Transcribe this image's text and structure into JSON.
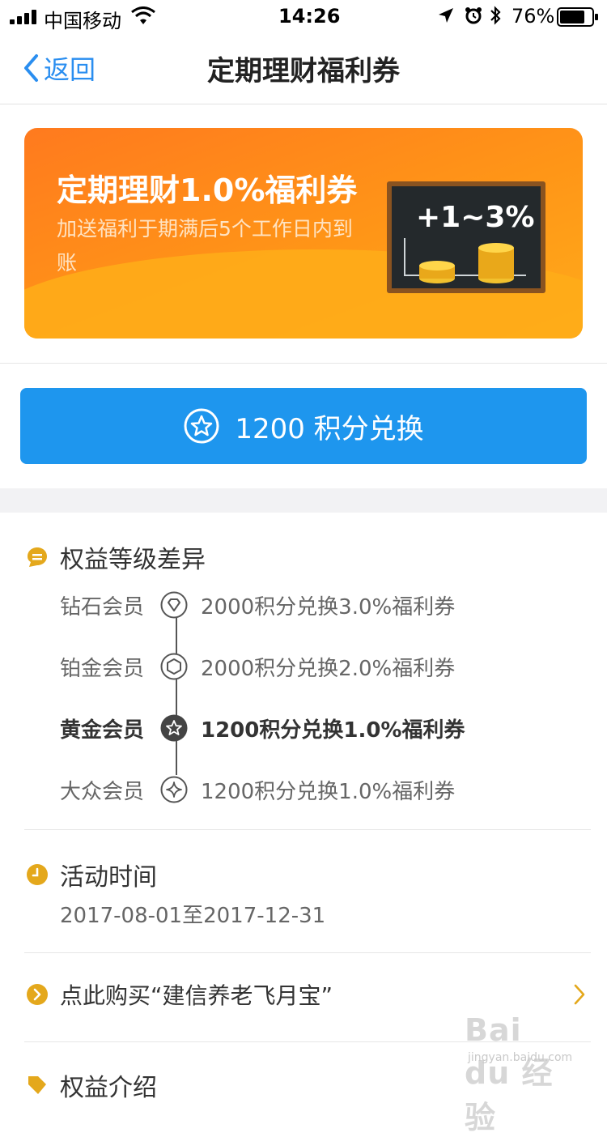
{
  "status_bar": {
    "carrier": "中国移动",
    "time": "14:26",
    "battery": "76%"
  },
  "nav": {
    "back_label": "返回",
    "title": "定期理财福利券"
  },
  "banner": {
    "title": "定期理财1.0%福利券",
    "subtitle": "加送福利于期满后5个工作日内到账",
    "board_text": "+1~3%"
  },
  "exchange_button": {
    "label": "1200 积分兑换"
  },
  "tiers_section": {
    "title": "权益等级差异",
    "tiers": [
      {
        "name": "钻石会员",
        "benefit": "2000积分兑换3.0%福利券",
        "icon": "diamond-icon",
        "active": false
      },
      {
        "name": "铂金会员",
        "benefit": "2000积分兑换2.0%福利券",
        "icon": "hexagon-icon",
        "active": false
      },
      {
        "name": "黄金会员",
        "benefit": "1200积分兑换1.0%福利券",
        "icon": "star-icon",
        "active": true
      },
      {
        "name": "大众会员",
        "benefit": "1200积分兑换1.0%福利券",
        "icon": "sparkle-icon",
        "active": false
      }
    ]
  },
  "activity_section": {
    "title": "活动时间",
    "date_range": "2017-08-01至2017-12-31"
  },
  "buy_link": {
    "label": "点此购买“建信养老飞月宝”"
  },
  "next_section": {
    "title": "权益介绍"
  },
  "watermark": {
    "brand": "Bai du 经验",
    "url": "jingyan.baidu.com"
  },
  "colors": {
    "accent_blue": "#1e96ee",
    "nav_blue": "#2a8ef0",
    "icon_gold": "#e4a81c",
    "banner_orange": "#ff8a1c"
  }
}
